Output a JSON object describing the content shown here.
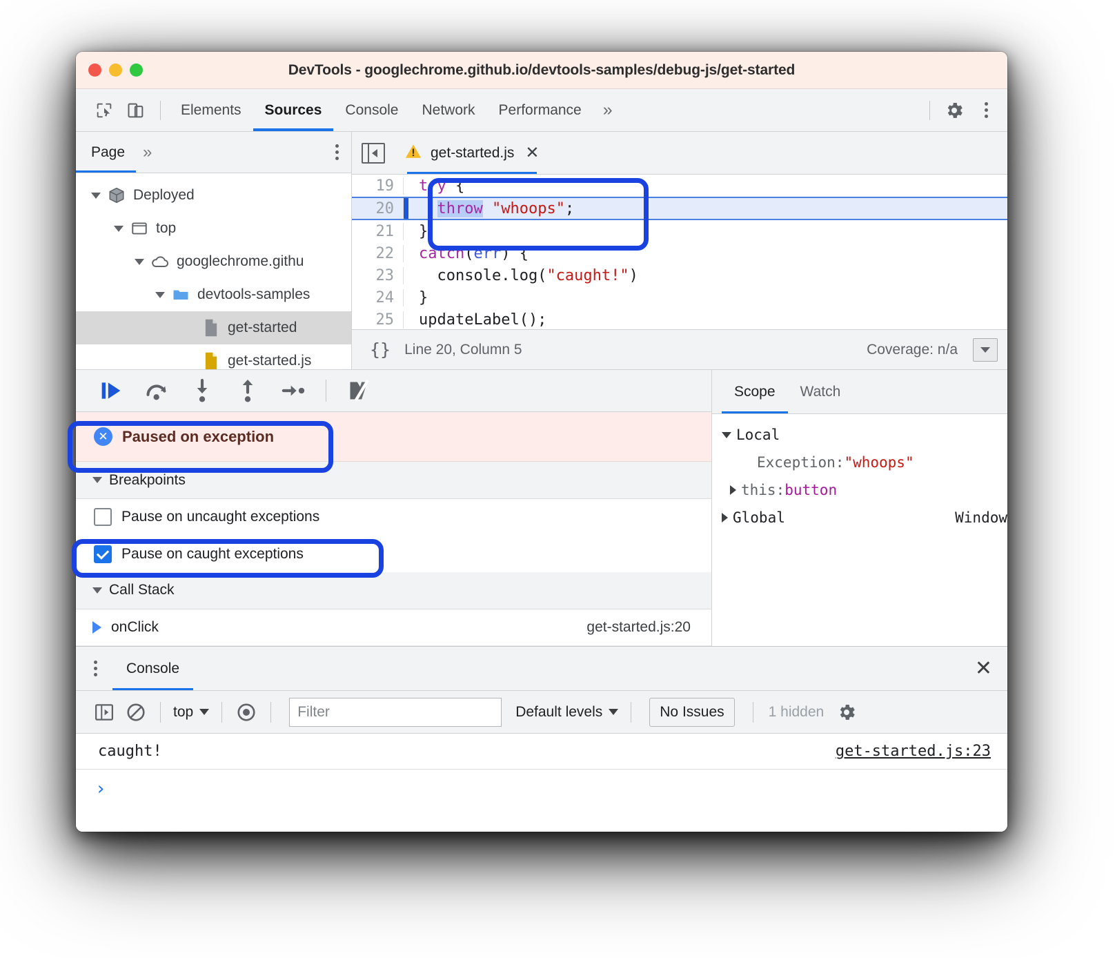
{
  "window": {
    "title": "DevTools - googlechrome.github.io/devtools-samples/debug-js/get-started"
  },
  "toolbar": {
    "inspect_icon": "inspect-cursor-icon",
    "device_icon": "device-toolbar-icon",
    "tabs": [
      {
        "label": "Elements",
        "active": false
      },
      {
        "label": "Sources",
        "active": true
      },
      {
        "label": "Console",
        "active": false
      },
      {
        "label": "Network",
        "active": false
      },
      {
        "label": "Performance",
        "active": false
      }
    ],
    "more_tabs": "»",
    "settings_icon": "gear-icon",
    "menu_icon": "kebab-menu-icon"
  },
  "navigator": {
    "tab_label": "Page",
    "more_label": "»",
    "tree": [
      {
        "label": "Deployed",
        "icon": "package-icon",
        "depth": 0,
        "expanded": true,
        "selected": false
      },
      {
        "label": "top",
        "icon": "frame-icon",
        "depth": 1,
        "expanded": true,
        "selected": false
      },
      {
        "label": "googlechrome.githu",
        "icon": "cloud-icon",
        "depth": 2,
        "expanded": true,
        "selected": false
      },
      {
        "label": "devtools-samples",
        "icon": "folder-icon",
        "depth": 3,
        "expanded": true,
        "selected": false
      },
      {
        "label": "get-started",
        "icon": "document-icon",
        "depth": 4,
        "expanded": false,
        "selected": true
      },
      {
        "label": "get-started.js",
        "icon": "script-icon",
        "depth": 4,
        "expanded": false,
        "selected": false
      }
    ]
  },
  "editor": {
    "tab_name": "get-started.js",
    "tab_warning_icon": "warning-triangle-icon",
    "sidebar_toggle_icon": "show-navigator-icon",
    "close_icon": "close-icon",
    "lines": [
      {
        "no": "19",
        "exec": false,
        "tokens": [
          {
            "t": "try",
            "c": "kw"
          },
          {
            "t": " {",
            "c": "pln"
          }
        ]
      },
      {
        "no": "20",
        "exec": true,
        "tokens": [
          {
            "t": "  ",
            "c": "pln"
          },
          {
            "t": "throw",
            "c": "kw sel-tok"
          },
          {
            "t": " ",
            "c": "pln"
          },
          {
            "t": "\"whoops\"",
            "c": "str"
          },
          {
            "t": ";",
            "c": "pln"
          }
        ]
      },
      {
        "no": "21",
        "exec": false,
        "tokens": [
          {
            "t": "}",
            "c": "pln"
          }
        ]
      },
      {
        "no": "22",
        "exec": false,
        "tokens": [
          {
            "t": "catch",
            "c": "kw"
          },
          {
            "t": "(",
            "c": "pln"
          },
          {
            "t": "err",
            "c": "var"
          },
          {
            "t": ") {",
            "c": "pln"
          }
        ]
      },
      {
        "no": "23",
        "exec": false,
        "tokens": [
          {
            "t": "  console.log(",
            "c": "pln"
          },
          {
            "t": "\"caught!\"",
            "c": "str"
          },
          {
            "t": ")",
            "c": "pln"
          }
        ]
      },
      {
        "no": "24",
        "exec": false,
        "tokens": [
          {
            "t": "}",
            "c": "pln"
          }
        ]
      },
      {
        "no": "25",
        "exec": false,
        "tokens": [
          {
            "t": "updateLabel();",
            "c": "pln"
          }
        ]
      }
    ],
    "status": {
      "format_icon": "pretty-print-braces-icon",
      "position": "Line 20, Column 5",
      "coverage": "Coverage: n/a",
      "drawer_toggle_icon": "chevron-down-box-icon"
    }
  },
  "debugger": {
    "controls": [
      {
        "name": "resume-script-execution",
        "icon": "resume-icon"
      },
      {
        "name": "step-over-next-call",
        "icon": "step-over-icon"
      },
      {
        "name": "step-into-next-call",
        "icon": "step-into-icon"
      },
      {
        "name": "step-out-of-current-function",
        "icon": "step-out-icon"
      },
      {
        "name": "step",
        "icon": "step-icon"
      },
      {
        "name": "deactivate-breakpoints",
        "icon": "deactivate-breakpoints-icon"
      }
    ],
    "paused_icon": "pause-exception-icon",
    "paused_text": "Paused on exception",
    "breakpoints_header": "Breakpoints",
    "breakpoint_options": [
      {
        "label": "Pause on uncaught exceptions",
        "checked": false
      },
      {
        "label": "Pause on caught exceptions",
        "checked": true
      }
    ],
    "call_stack_header": "Call Stack",
    "call_stack": [
      {
        "name": "onClick",
        "location": "get-started.js:20",
        "active": true
      }
    ]
  },
  "scope": {
    "tabs": [
      {
        "label": "Scope",
        "active": true
      },
      {
        "label": "Watch",
        "active": false
      }
    ],
    "rows": [
      {
        "caret": "open",
        "indent": 0,
        "name": "Local",
        "sep": "",
        "value": "",
        "value_class": "",
        "right": ""
      },
      {
        "caret": "none",
        "indent": 1,
        "name": "Exception",
        "sep": ": ",
        "value": "\"whoops\"",
        "value_class": "s-str",
        "right": ""
      },
      {
        "caret": "closed",
        "indent": 1,
        "name": "this",
        "sep": ": ",
        "value": "button",
        "value_class": "s-obj",
        "right": ""
      },
      {
        "caret": "closed",
        "indent": 0,
        "name": "Global",
        "sep": "",
        "value": "",
        "value_class": "",
        "right": "Window"
      }
    ]
  },
  "drawer": {
    "menu_icon": "kebab-menu-icon",
    "tab_label": "Console",
    "close_icon": "close-icon",
    "toolbar": {
      "sidebar_icon": "console-sidebar-icon",
      "clear_icon": "clear-console-icon",
      "context_label": "top",
      "eye_icon": "live-expression-icon",
      "filter_placeholder": "Filter",
      "filter_value": "",
      "levels_label": "Default levels",
      "issues_label": "No Issues",
      "hidden_label": "1 hidden",
      "settings_icon": "gear-icon"
    },
    "messages": [
      {
        "text": "caught!",
        "link": "get-started.js:23"
      }
    ],
    "prompt_symbol": "›"
  },
  "annotations": {
    "color": "#1a42e0",
    "boxes": [
      {
        "name": "code-throw-highlight"
      },
      {
        "name": "paused-on-exception-highlight"
      },
      {
        "name": "pause-on-caught-checkbox-highlight"
      }
    ]
  }
}
